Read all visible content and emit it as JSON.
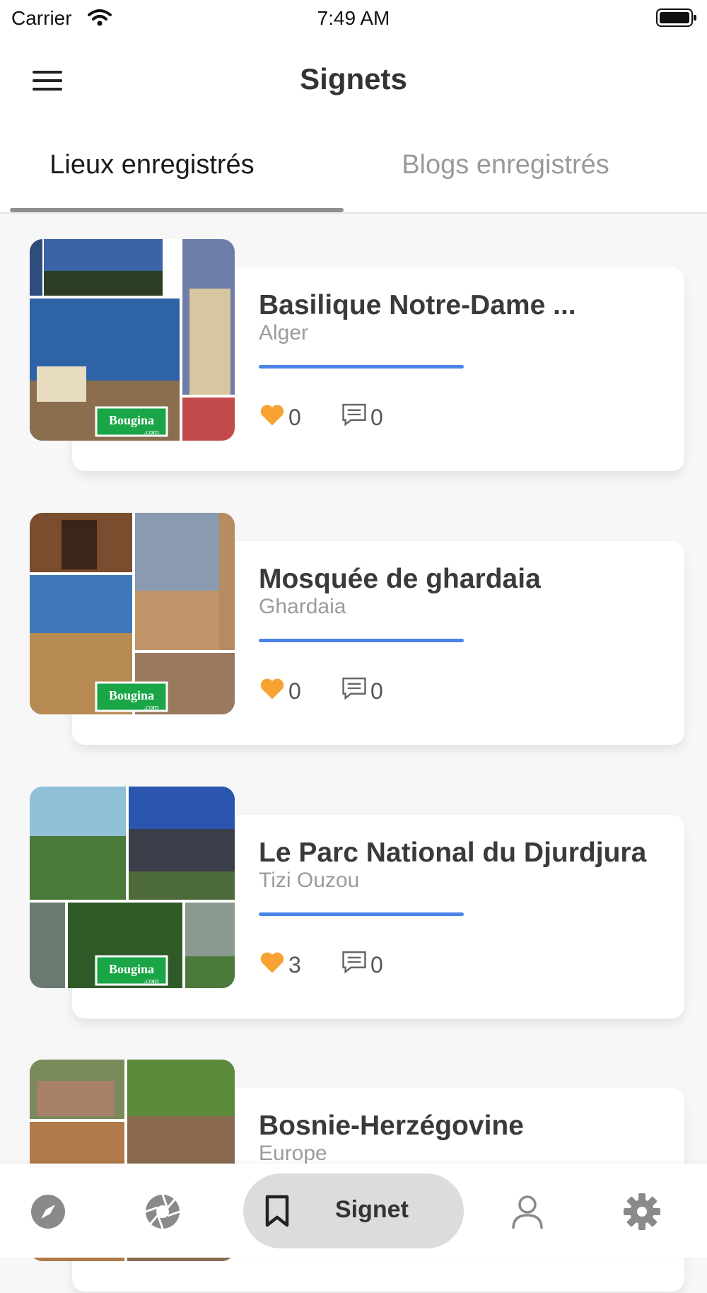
{
  "status_bar": {
    "carrier": "Carrier",
    "time": "7:49 AM"
  },
  "header": {
    "title": "Signets"
  },
  "tabs": [
    {
      "label": "Lieux enregistrés",
      "active": true
    },
    {
      "label": "Blogs enregistrés",
      "active": false
    }
  ],
  "places": [
    {
      "title": "Basilique Notre-Dame ...",
      "location": "Alger",
      "likes": "0",
      "comments": "0"
    },
    {
      "title": "Mosquée de ghardaia",
      "location": "Ghardaia",
      "likes": "0",
      "comments": "0"
    },
    {
      "title": "Le Parc National du Djurdjura",
      "location": "Tizi Ouzou",
      "likes": "3",
      "comments": "0"
    },
    {
      "title": "Bosnie-Herzégovine",
      "location": "Europe",
      "likes": "",
      "comments": ""
    }
  ],
  "thumb_watermark": "Bougina.com",
  "bottom_nav": {
    "items": [
      "compass-icon",
      "camera-aperture-icon",
      "bookmark-icon",
      "user-icon",
      "gear-icon"
    ],
    "active_label": "Signet"
  },
  "colors": {
    "accent_blue": "#4b84e8",
    "heart": "#f7a233",
    "nav_active_bg": "#dcdcdc"
  }
}
